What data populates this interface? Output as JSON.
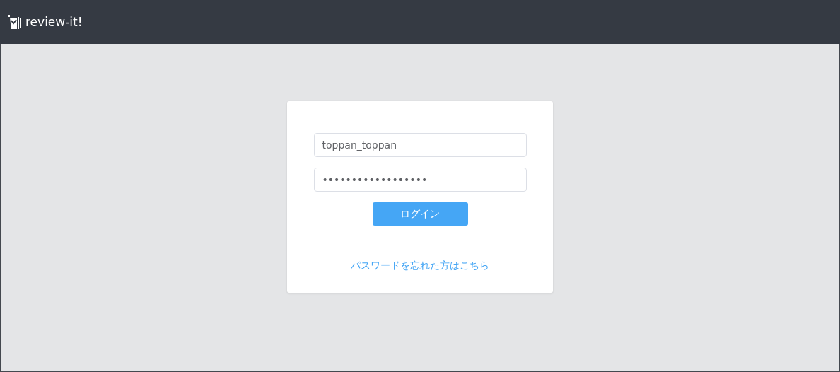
{
  "header": {
    "logo_text": "review-it!"
  },
  "login_form": {
    "username": {
      "value": "toppan_toppan"
    },
    "password": {
      "value": "••••••••••••••••••"
    },
    "login_button": "ログイン",
    "forgot_password_link": "パスワードを忘れた方はこちら"
  }
}
